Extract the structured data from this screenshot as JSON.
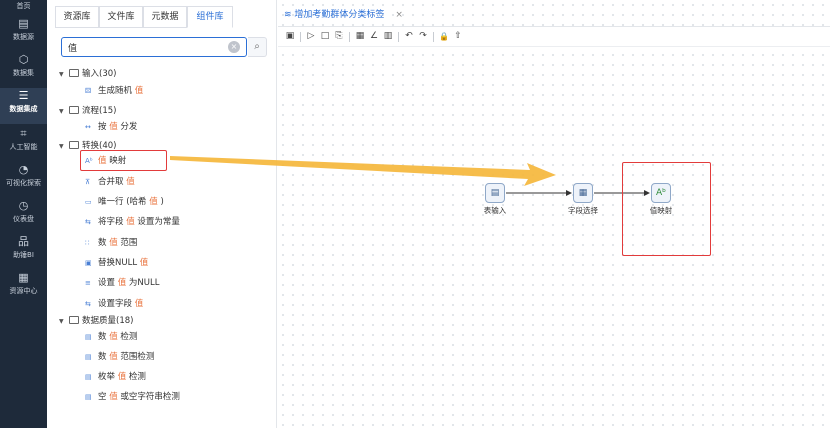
{
  "nav": {
    "items": [
      {
        "label": "首页",
        "icon": "home-icon",
        "glyph": ""
      },
      {
        "label": "数据源",
        "icon": "database-icon",
        "glyph": "▤"
      },
      {
        "label": "数据集",
        "icon": "cube-icon",
        "glyph": "⬡"
      },
      {
        "label": "数据集成",
        "icon": "layers-icon",
        "glyph": "☰"
      },
      {
        "label": "人工智能",
        "icon": "ai-icon",
        "glyph": "⌗"
      },
      {
        "label": "可视化探索",
        "icon": "pie-icon",
        "glyph": "◔"
      },
      {
        "label": "仪表盘",
        "icon": "gauge-icon",
        "glyph": "◷"
      },
      {
        "label": "助锤BI",
        "icon": "org-chart-icon",
        "glyph": "品"
      },
      {
        "label": "资源中心",
        "icon": "resource-icon",
        "glyph": "▦"
      }
    ]
  },
  "panel": {
    "tabs": [
      "资源库",
      "文件库",
      "元数据",
      "组件库"
    ],
    "search_value": "值",
    "clear_glyph": "×",
    "search_glyph": "⌕"
  },
  "tree": {
    "input": {
      "label": "输入(30)"
    },
    "input_items": [
      {
        "pre": "生成随机 ",
        "hl": "值",
        "post": "",
        "glyph": "⚄"
      }
    ],
    "flow": {
      "label": "流程(15)"
    },
    "flow_items": [
      {
        "pre": "按 ",
        "hl": "值",
        "post": " 分发",
        "glyph": "↔"
      }
    ],
    "transform": {
      "label": "转换(40)"
    },
    "transform_items": [
      {
        "pre": "",
        "hl": "值",
        "post": " 映射",
        "glyph": "Aᵇ"
      },
      {
        "pre": "合并取 ",
        "hl": "值",
        "post": "",
        "glyph": "⊼"
      },
      {
        "pre": "唯一行 (哈希 ",
        "hl": "值",
        "post": " )",
        "glyph": "▭"
      },
      {
        "pre": "将字段 ",
        "hl": "值",
        "post": " 设置为常量",
        "glyph": "⇆"
      },
      {
        "pre": "数 ",
        "hl": "值",
        "post": " 范围",
        "glyph": "∷"
      },
      {
        "pre": "替换NULL ",
        "hl": "值",
        "post": "",
        "glyph": "▣"
      },
      {
        "pre": "设置 ",
        "hl": "值",
        "post": " 为NULL",
        "glyph": "≡"
      },
      {
        "pre": "设置字段 ",
        "hl": "值",
        "post": "",
        "glyph": "⇆"
      }
    ],
    "quality": {
      "label": "数据质量(18)"
    },
    "quality_items": [
      {
        "pre": "数 ",
        "hl": "值",
        "post": " 检测",
        "glyph": "▤"
      },
      {
        "pre": "数 ",
        "hl": "值",
        "post": " 范围检测",
        "glyph": "▤"
      },
      {
        "pre": "枚举 ",
        "hl": "值",
        "post": " 检测",
        "glyph": "▤"
      },
      {
        "pre": "空 ",
        "hl": "值",
        "post": " 或空字符串检测",
        "glyph": "▤"
      }
    ]
  },
  "editor": {
    "tab_title": "增加考勤群体分类标签",
    "tab_close": "×",
    "toolbar": [
      {
        "name": "save-icon",
        "glyph": "▣"
      },
      {
        "name": "run-icon",
        "glyph": "▷"
      },
      {
        "name": "stop-icon",
        "glyph": "□"
      },
      {
        "name": "preview-icon",
        "glyph": "⎘"
      },
      {
        "name": "table-icon",
        "glyph": "▦"
      },
      {
        "name": "chart-icon",
        "glyph": "∠"
      },
      {
        "name": "grid-icon",
        "glyph": "▥"
      },
      {
        "name": "undo-icon",
        "glyph": "↶"
      },
      {
        "name": "redo-icon",
        "glyph": "↷"
      },
      {
        "name": "lock-icon",
        "glyph": "🔒"
      },
      {
        "name": "upload-icon",
        "glyph": "⇧"
      }
    ],
    "nodes": [
      {
        "label": "表输入",
        "glyph": "▤"
      },
      {
        "label": "字段选择",
        "glyph": "▦"
      },
      {
        "label": "值映射",
        "glyph": "Aᵇ"
      }
    ]
  }
}
